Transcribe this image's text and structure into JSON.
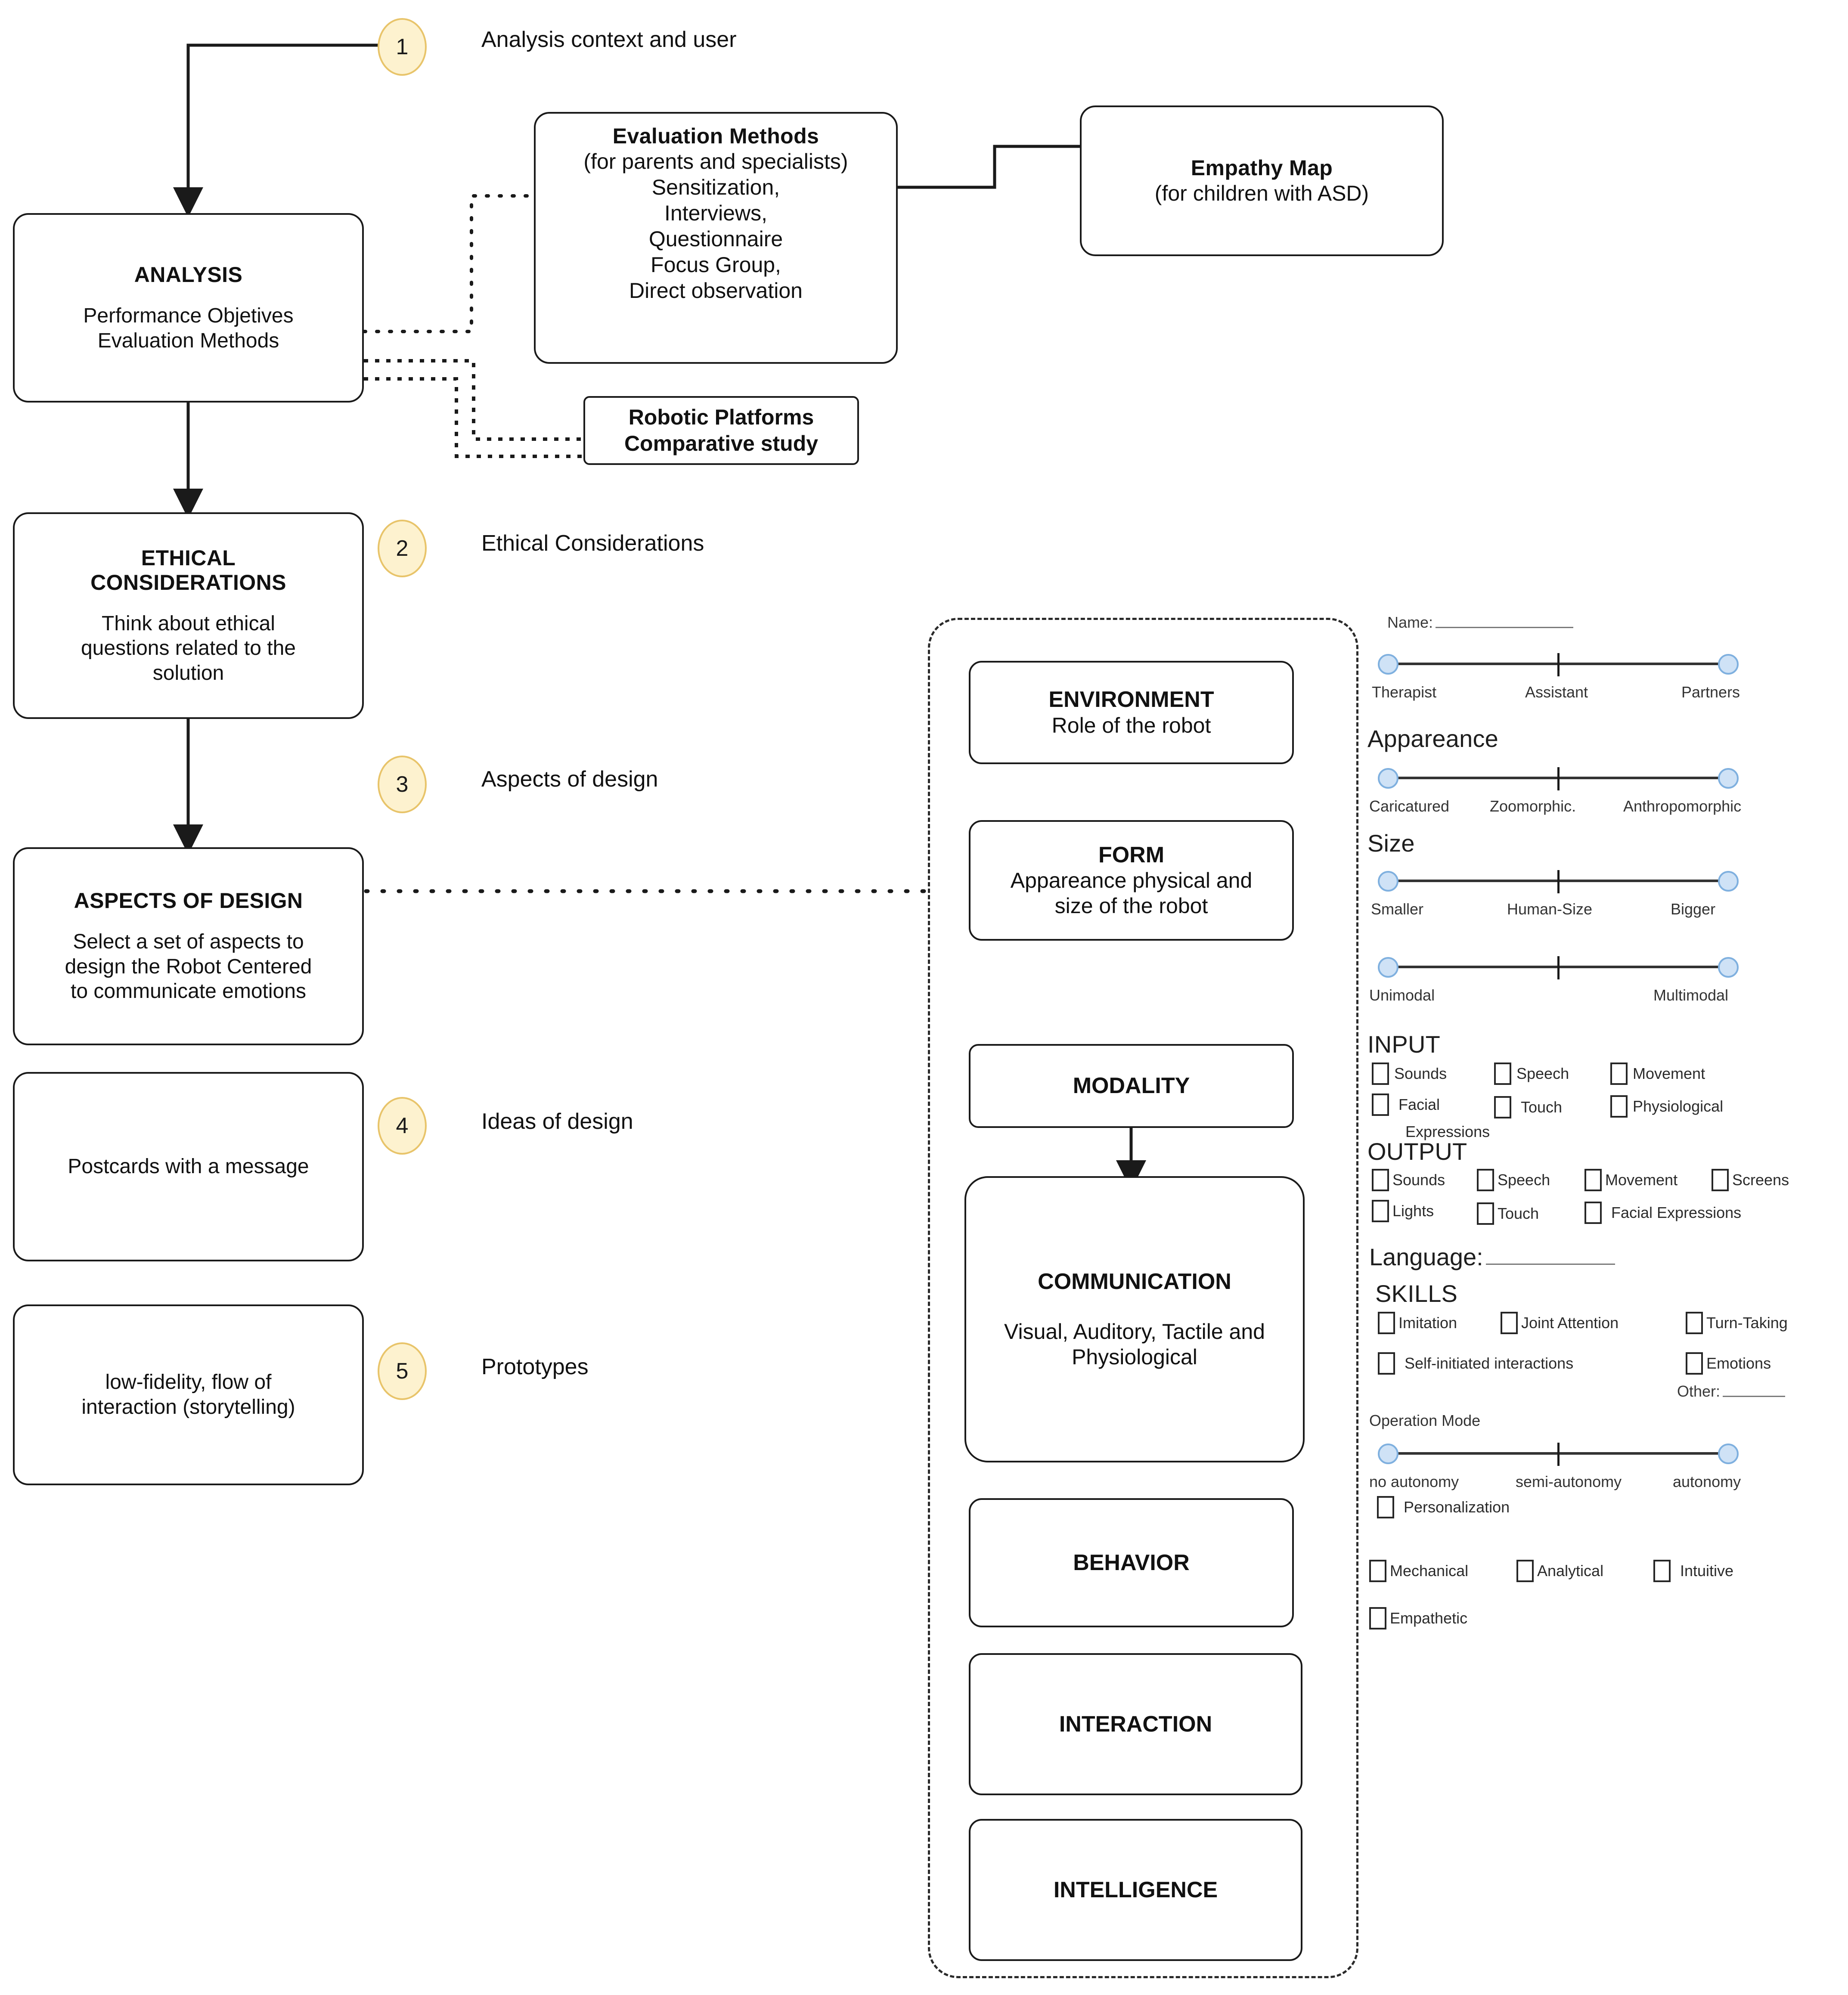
{
  "meta": {
    "accent_step_fill": "#fdf2cf",
    "accent_step_border": "#e8c46a",
    "slider_knob_fill": "#cfe2f6",
    "slider_knob_border": "#7fb0df",
    "line_color": "#1a1a1a"
  },
  "steps": [
    {
      "number": "1",
      "label": "Analysis context and user"
    },
    {
      "number": "2",
      "label": "Ethical Considerations"
    },
    {
      "number": "3",
      "label": "Aspects of design"
    },
    {
      "number": "4",
      "label": "Ideas of design"
    },
    {
      "number": "5",
      "label": "Prototypes"
    }
  ],
  "flow": {
    "analysis": {
      "title": "ANALYSIS",
      "line1": "Performance Objetives",
      "line2": "Evaluation Methods"
    },
    "ethical": {
      "title_line1": "ETHICAL",
      "title_line2": "CONSIDERATIONS",
      "line1": "Think about ethical",
      "line2": "questions related to the",
      "line3": "solution"
    },
    "aspects": {
      "title": "ASPECTS OF DESIGN",
      "line1": "Select a set of aspects  to",
      "line2": "design the Robot Centered",
      "line3": "to communicate emotions"
    },
    "ideas": {
      "line1": "Postcards with a message"
    },
    "prototypes": {
      "line1": "low-fidelity, flow of",
      "line2": "interaction (storytelling)"
    }
  },
  "evaluation_methods": {
    "title": "Evaluation Methods",
    "lines": [
      "(for parents and specialists)",
      "Sensitization,",
      "Interviews,",
      "Questionnaire",
      "Focus Group,",
      "Direct observation"
    ]
  },
  "empathy_map": {
    "title": "Empathy Map",
    "subtitle": "(for children with ASD)"
  },
  "robotic_platforms": {
    "line1": "Robotic Platforms",
    "line2": "Comparative study"
  },
  "aspect_boxes": [
    {
      "title": "ENVIRONMENT",
      "sub": "Role of the robot",
      "sub2": ""
    },
    {
      "title": "FORM",
      "sub": "Appareance physical and",
      "sub2": "size of the robot"
    },
    {
      "title": "MODALITY",
      "sub": "",
      "sub2": ""
    },
    {
      "title": "COMMUNICATION",
      "sub": "Visual, Auditory, Tactile and",
      "sub2": "Physiological"
    },
    {
      "title": "BEHAVIOR",
      "sub": "",
      "sub2": ""
    },
    {
      "title": "INTERACTION",
      "sub": "",
      "sub2": ""
    },
    {
      "title": "INTELLIGENCE",
      "sub": "",
      "sub2": ""
    }
  ],
  "panel": {
    "name_label": "Name:",
    "name_value": "",
    "role_slider": {
      "left": "Therapist",
      "mid": "Assistant",
      "right": "Partners"
    },
    "appearance_heading": "Appareance",
    "appearance_slider": {
      "left": "Caricatured",
      "mid": "Zoomorphic.",
      "right": "Anthropomorphic"
    },
    "size_heading": "Size",
    "size_slider": {
      "left": "Smaller",
      "mid": "Human-Size",
      "right": "Bigger"
    },
    "modality_slider": {
      "left": "Unimodal",
      "mid": "",
      "right": "Multimodal"
    },
    "input_heading": "INPUT",
    "input_items": [
      "Sounds",
      "Speech",
      "Movement",
      "Facial",
      "Touch",
      "Physiological",
      "Expressions"
    ],
    "output_heading": "OUTPUT",
    "output_items": [
      "Sounds",
      "Speech",
      "Movement",
      "Screens",
      "Lights",
      "Touch",
      "Facial Expressions"
    ],
    "language_label": "Language:",
    "language_value": "",
    "skills_heading": "SKILLS",
    "skills_items": [
      "Imitation",
      "Joint Attention",
      "Turn-Taking",
      "Self-initiated interactions",
      "Emotions"
    ],
    "other_label": "Other:",
    "other_value": "",
    "operation_mode_heading": "Operation Mode",
    "operation_mode_slider": {
      "left": "no autonomy",
      "mid": "semi-autonomy",
      "right": "autonomy"
    },
    "personalization": "Personalization",
    "intelligence_items": [
      "Mechanical",
      "Analytical",
      "Intuitive",
      "Empathetic"
    ]
  }
}
